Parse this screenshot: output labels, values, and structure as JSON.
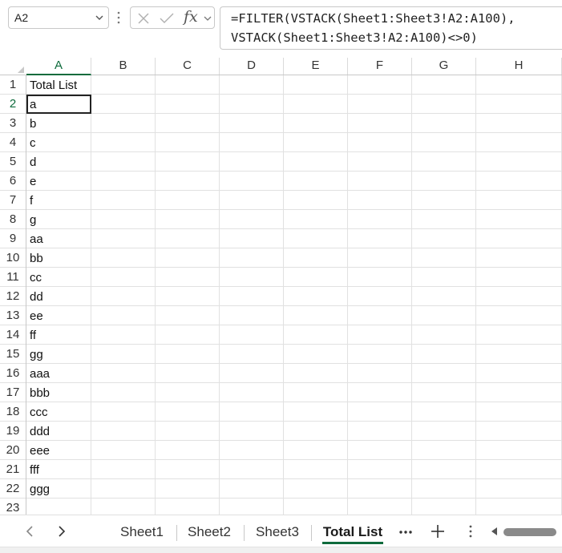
{
  "formula_bar": {
    "name_box": "A2",
    "fx_label": "fx",
    "formula_line1": "=FILTER(VSTACK(Sheet1:Sheet3!A2:A100),",
    "formula_line2": "VSTACK(Sheet1:Sheet3!A2:A100)<>0)"
  },
  "grid": {
    "columns": [
      "A",
      "B",
      "C",
      "D",
      "E",
      "F",
      "G",
      "H"
    ],
    "selected_column": "A",
    "active_cell": "A2",
    "rows": [
      {
        "num": "1",
        "a": "Total List"
      },
      {
        "num": "2",
        "a": "a"
      },
      {
        "num": "3",
        "a": "b"
      },
      {
        "num": "4",
        "a": "c"
      },
      {
        "num": "5",
        "a": "d"
      },
      {
        "num": "6",
        "a": "e"
      },
      {
        "num": "7",
        "a": "f"
      },
      {
        "num": "8",
        "a": "g"
      },
      {
        "num": "9",
        "a": "aa"
      },
      {
        "num": "10",
        "a": "bb"
      },
      {
        "num": "11",
        "a": "cc"
      },
      {
        "num": "12",
        "a": "dd"
      },
      {
        "num": "13",
        "a": "ee"
      },
      {
        "num": "14",
        "a": "ff"
      },
      {
        "num": "15",
        "a": "gg"
      },
      {
        "num": "16",
        "a": "aaa"
      },
      {
        "num": "17",
        "a": "bbb"
      },
      {
        "num": "18",
        "a": "ccc"
      },
      {
        "num": "19",
        "a": "ddd"
      },
      {
        "num": "20",
        "a": "eee"
      },
      {
        "num": "21",
        "a": "fff"
      },
      {
        "num": "22",
        "a": "ggg"
      },
      {
        "num": "23",
        "a": ""
      }
    ]
  },
  "sheet_tabs": {
    "tabs": [
      "Sheet1",
      "Sheet2",
      "Sheet3",
      "Total List"
    ],
    "active": "Total List"
  },
  "colors": {
    "accent": "#0e6b3c",
    "gridline": "#e1e1e1"
  },
  "icons": {
    "name_box_dropdown": "chevron-down-icon",
    "more_options": "vertical-dots-icon",
    "cancel": "x-icon",
    "enter": "check-icon",
    "insert_function": "fx-icon",
    "prev_sheet": "chevron-left-icon",
    "next_sheet": "chevron-right-icon",
    "more_sheets": "ellipsis-icon",
    "add_sheet": "plus-icon",
    "sheet_options": "vertical-dots-icon"
  }
}
